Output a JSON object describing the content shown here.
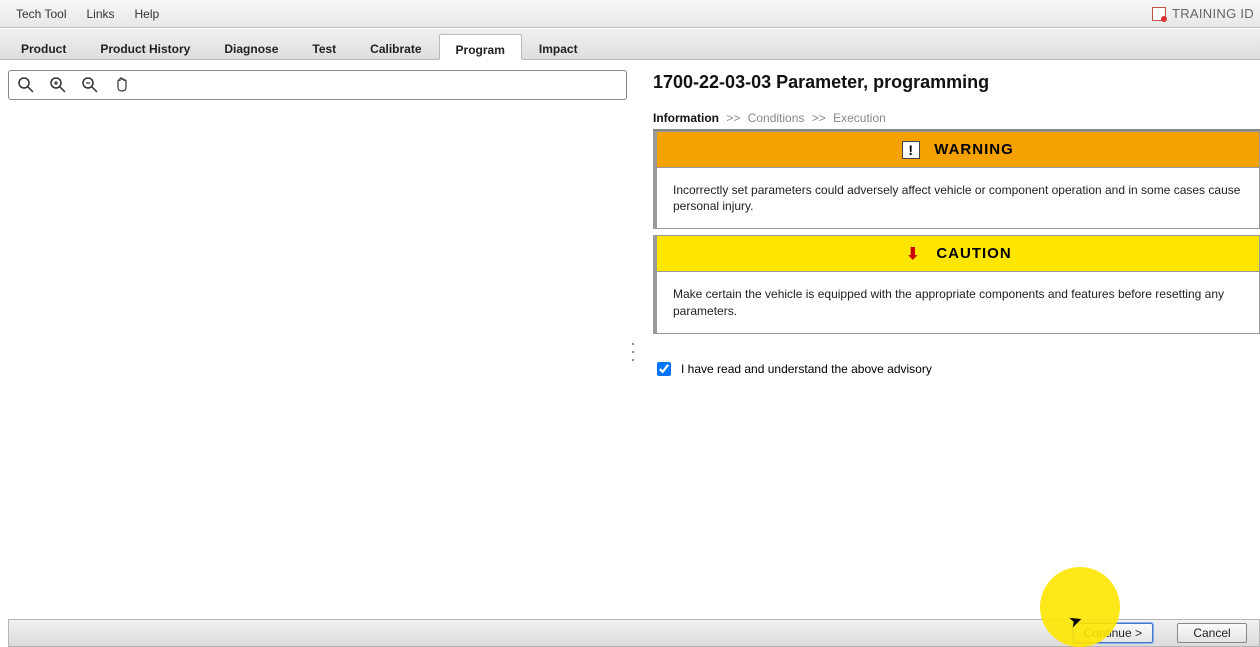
{
  "menubar": {
    "items": [
      "Tech Tool",
      "Links",
      "Help"
    ],
    "right_label": "TRAINING ID"
  },
  "tabs": {
    "items": [
      "Product",
      "Product History",
      "Diagnose",
      "Test",
      "Calibrate",
      "Program",
      "Impact"
    ],
    "active_index": 5
  },
  "page": {
    "title": "1700-22-03-03 Parameter, programming"
  },
  "breadcrumb": {
    "steps": [
      "Information",
      "Conditions",
      "Execution"
    ],
    "active_index": 0,
    "separator": ">>"
  },
  "alerts": {
    "warning": {
      "label": "WARNING",
      "text": "Incorrectly set parameters could adversely affect vehicle or component operation and in some cases cause personal injury."
    },
    "caution": {
      "label": "CAUTION",
      "text": "Make certain the vehicle is equipped with the appropriate components and features before resetting any parameters."
    }
  },
  "ack": {
    "label": "I have read and understand the above advisory",
    "checked": true
  },
  "buttons": {
    "continue": "Continue >",
    "cancel": "Cancel"
  },
  "toolbar_icons": [
    "zoom-fit-icon",
    "zoom-in-icon",
    "zoom-out-icon",
    "pan-hand-icon"
  ]
}
